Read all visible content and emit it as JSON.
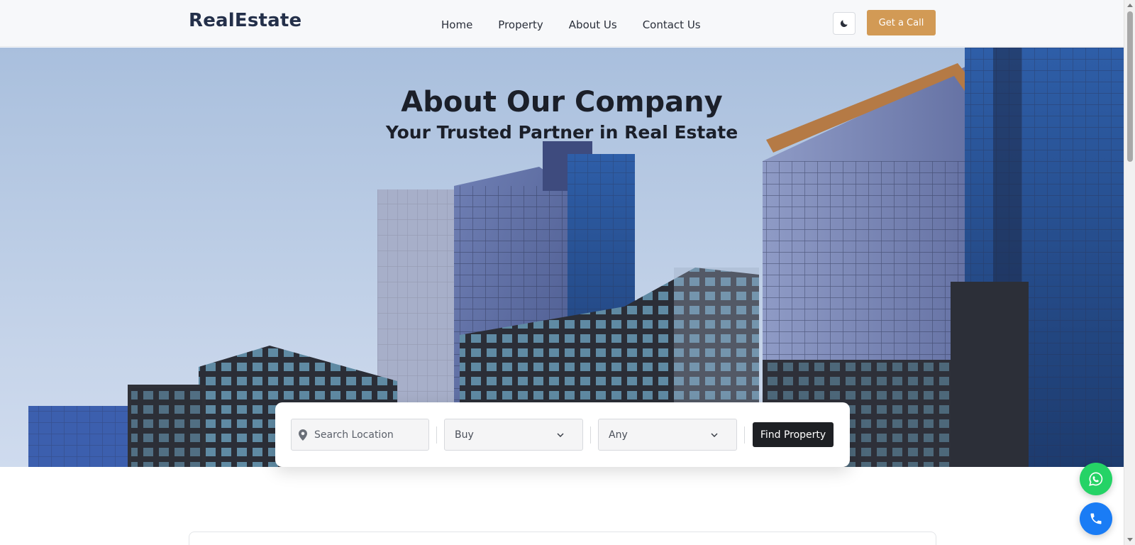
{
  "navbar": {
    "logo": "RealEstate",
    "links": [
      "Home",
      "Property",
      "About Us",
      "Contact Us"
    ],
    "theme_toggle_icon": "moon-icon",
    "cta_label": "Get a Call"
  },
  "hero": {
    "title": "About Our Company",
    "subtitle": "Your Trusted Partner in Real Estate",
    "background_image": "city-skyscrapers-photo"
  },
  "search": {
    "location_placeholder": "Search Location",
    "location_icon": "map-pin-icon",
    "type_selected": "Buy",
    "price_selected": "Any",
    "button_label": "Find Property"
  },
  "floating": {
    "whatsapp_icon": "whatsapp-icon",
    "phone_icon": "phone-icon"
  },
  "colors": {
    "accent": "#d29a55",
    "dark_button": "#1e2024",
    "whatsapp": "#25d366",
    "phone": "#1a7cf5"
  }
}
